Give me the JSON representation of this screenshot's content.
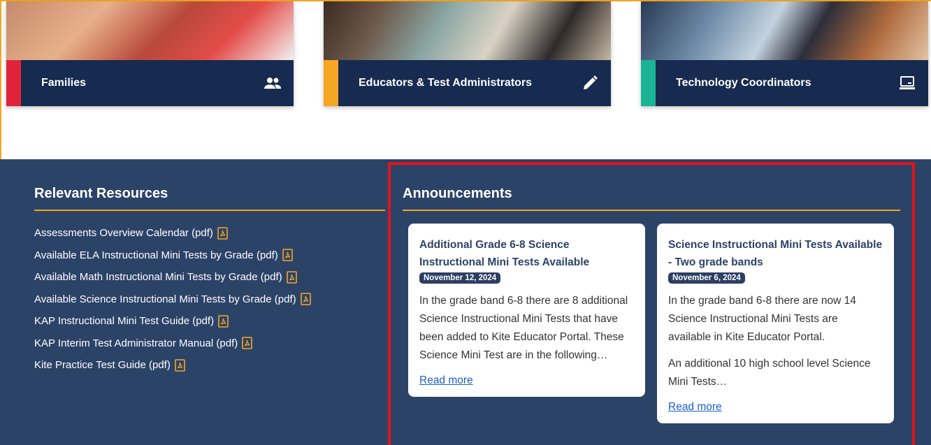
{
  "audience_cards": [
    {
      "label": "Families",
      "icon": "users-icon",
      "accent": "#e0233a"
    },
    {
      "label": "Educators & Test Administrators",
      "icon": "pencil-icon",
      "accent": "#f5a623"
    },
    {
      "label": "Technology Coordinators",
      "icon": "laptop-icon",
      "accent": "#1ab394"
    }
  ],
  "resources": {
    "heading": "Relevant Resources",
    "items": [
      "Assessments Overview Calendar (pdf)",
      "Available ELA Instructional Mini Tests by Grade (pdf)",
      "Available Math Instructional Mini Tests by Grade (pdf)",
      "Available Science Instructional Mini Tests by Grade (pdf)",
      "KAP Instructional Mini Test Guide (pdf)",
      "KAP Interim Test Administrator Manual (pdf)",
      "Kite Practice Test Guide (pdf)"
    ]
  },
  "announcements": {
    "heading": "Announcements",
    "items": [
      {
        "title": "Additional Grade 6-8 Science Instructional Mini Tests Available",
        "date": "November 12, 2024",
        "paragraphs": [
          "In the grade band 6-8 there are 8 additional Science Instructional Mini Tests that have been added to Kite Educator Portal. These Science Mini Test are in the following…"
        ],
        "link": "Read more"
      },
      {
        "title": "Science Instructional Mini Tests Available - Two grade bands",
        "date": "November 6, 2024",
        "paragraphs": [
          "In the grade band 6-8 there are now 14 Science Instructional Mini Tests are available in Kite Educator Portal.",
          "An additional 10 high school level Science Mini Tests…"
        ],
        "link": "Read more"
      }
    ]
  },
  "colors": {
    "navy": "#2c4368",
    "orange": "#f5a623",
    "highlight": "#e0141a"
  }
}
